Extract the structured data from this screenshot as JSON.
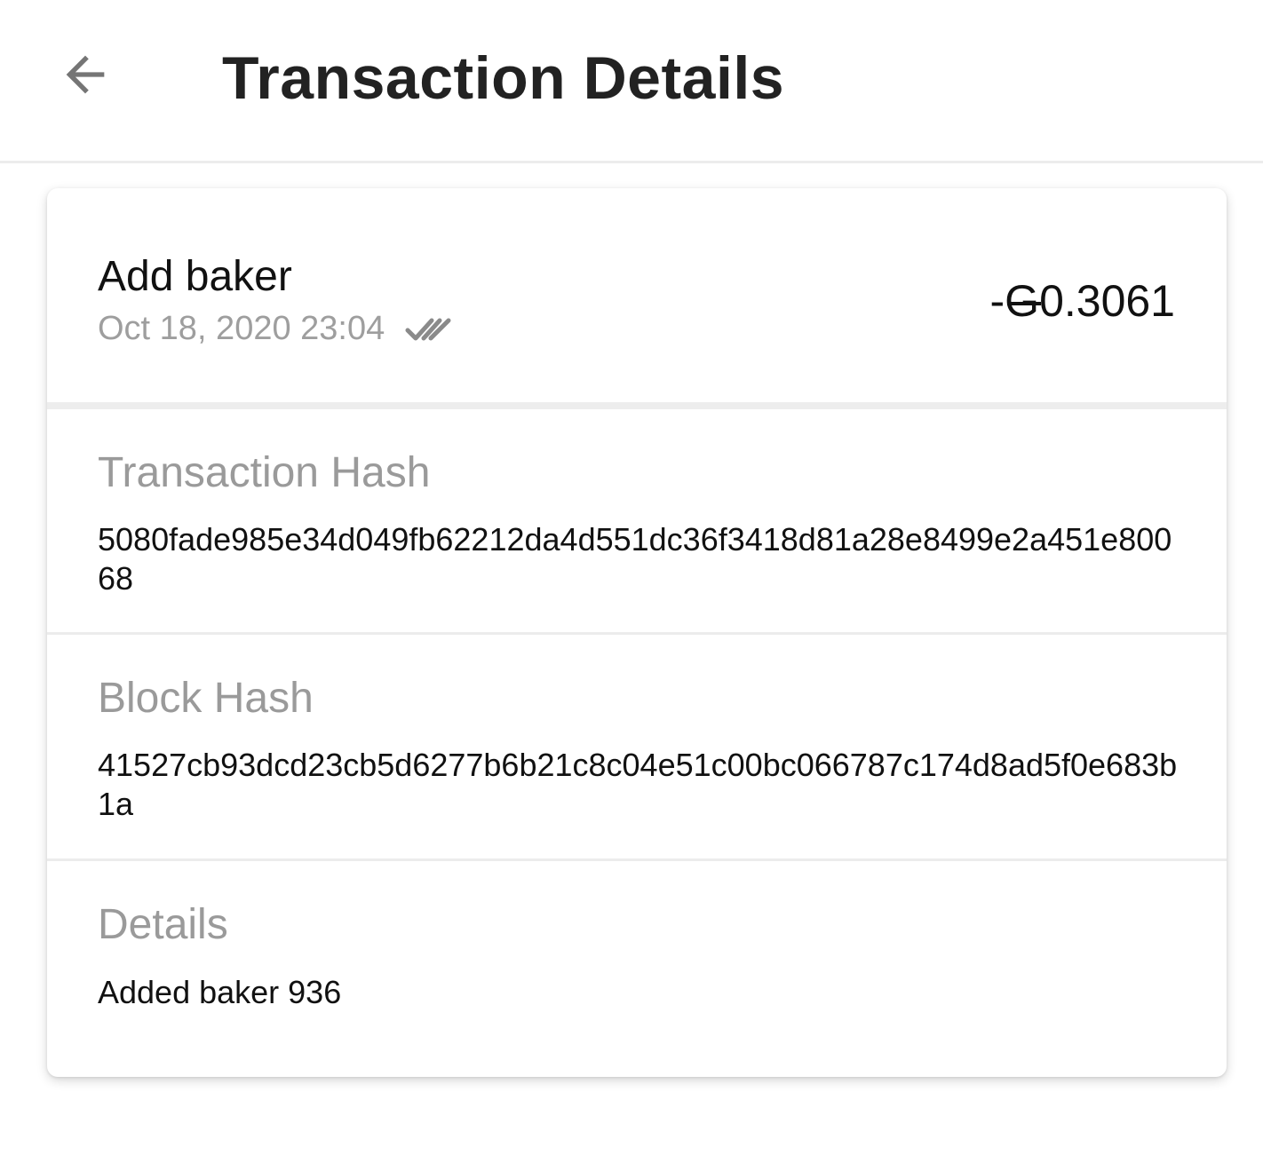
{
  "header": {
    "title": "Transaction Details",
    "back_icon": "arrow-back-icon"
  },
  "transaction": {
    "type": "Add baker",
    "date": "Oct 18, 2020 23:04",
    "status_icon": "double-check-icon",
    "amount_sign": "-",
    "amount_currency": "G",
    "amount_value": "0.3061"
  },
  "sections": {
    "transaction_hash": {
      "label": "Transaction Hash",
      "value": "5080fade985e34d049fb62212da4d551dc36f3418d81a28e8499e2a451e80068"
    },
    "block_hash": {
      "label": "Block Hash",
      "value": "41527cb93dcd23cb5d6277b6b21c8c04e51c00bc066787c174d8ad5f0e683b1a"
    },
    "details": {
      "label": "Details",
      "value": "Added baker 936"
    }
  },
  "colors": {
    "text_primary": "#111111",
    "text_secondary": "#9e9e9e",
    "divider": "#ececec",
    "background": "#ffffff"
  }
}
